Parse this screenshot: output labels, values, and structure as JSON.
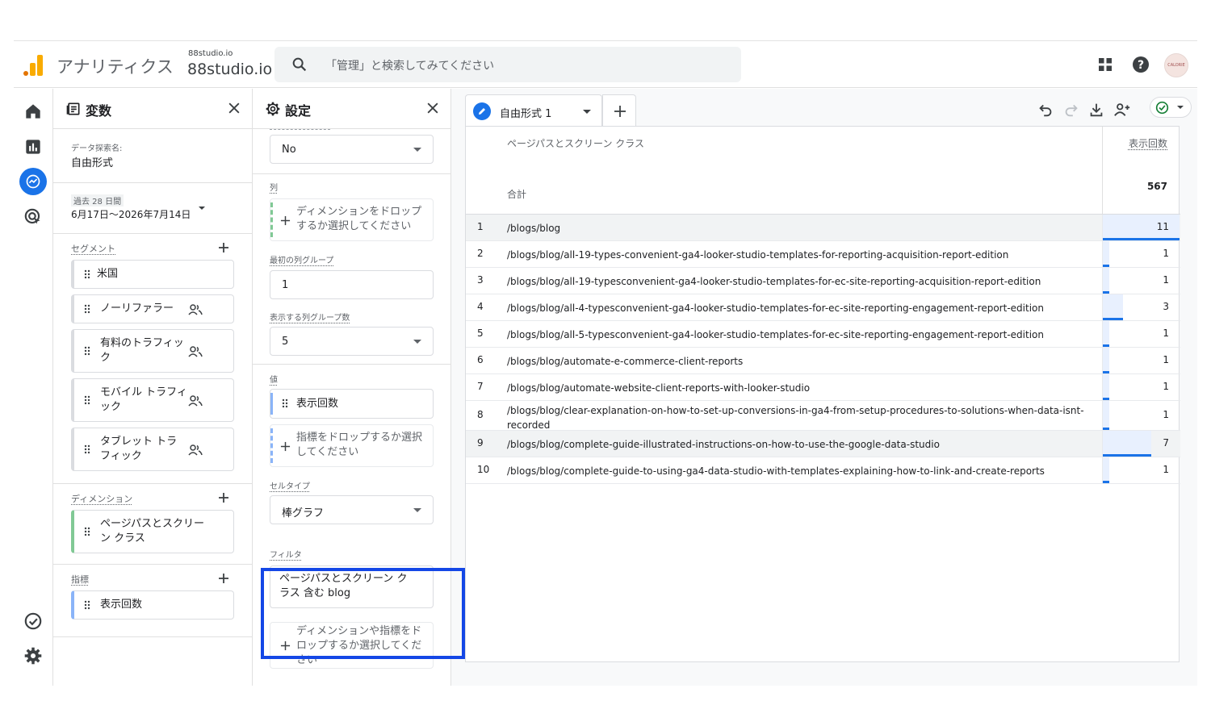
{
  "header": {
    "app_name": "アナリティクス",
    "property_small": "88studio.io",
    "property_name": "88studio.io",
    "search_placeholder": "「管理」と検索してみてください",
    "avatar_text": "CALORIE"
  },
  "variables_panel": {
    "title": "変数",
    "exploration_label": "データ探索名:",
    "exploration_name": "自由形式",
    "date_badge": "過去 28 日間",
    "date_range": "6月17日〜2026年7月14日",
    "segments_label": "セグメント",
    "segments": [
      "米国",
      "ノーリファラー",
      "有料のトラフィック",
      "モバイル トラフィック",
      "タブレット トラフィック"
    ],
    "dimensions_label": "ディメンション",
    "dimensions": [
      "ページパスとスクリーン クラス"
    ],
    "metrics_label": "指標",
    "metrics": [
      "表示回数"
    ]
  },
  "settings_panel": {
    "title": "設定",
    "show_rows_value": "No",
    "columns_label": "列",
    "columns_drop": "ディメンションをドロップするか選択してください",
    "first_group_label": "最初の列グループ",
    "first_group_value": "1",
    "groups_count_label": "表示する列グループ数",
    "groups_count_value": "5",
    "values_label": "値",
    "value_item": "表示回数",
    "values_drop": "指標をドロップするか選択してください",
    "cell_type_label": "セルタイプ",
    "cell_type_value": "棒グラフ",
    "filter_label": "フィルタ",
    "filter_value": "ページパスとスクリーン クラス 含む blog",
    "filter_drop": "ディメンションや指標をドロップするか選択してください"
  },
  "canvas": {
    "tab_name": "自由形式 1",
    "dimension_header": "ページパスとスクリーン クラス",
    "metric_header": "表示回数",
    "total_label": "合計",
    "total_value": "567",
    "rows": [
      {
        "n": "1",
        "path": "/blogs/blog",
        "value": "11",
        "share": 1.0
      },
      {
        "n": "2",
        "path": "/blogs/blog/all-19-types-convenient-ga4-looker-studio-templates-for-reporting-acquisition-report-edition",
        "value": "1",
        "share": 0.09
      },
      {
        "n": "3",
        "path": "/blogs/blog/all-19-typesconvenient-ga4-looker-studio-templates-for-ec-site-reporting-acquisition-report-edition",
        "value": "1",
        "share": 0.09
      },
      {
        "n": "4",
        "path": "/blogs/blog/all-4-typesconvenient-ga4-looker-studio-templates-for-ec-site-reporting-engagement-report-edition",
        "value": "3",
        "share": 0.27
      },
      {
        "n": "5",
        "path": "/blogs/blog/all-5-typesconvenient-ga4-looker-studio-templates-for-ec-site-reporting-engagement-report-edition",
        "value": "1",
        "share": 0.09
      },
      {
        "n": "6",
        "path": "/blogs/blog/automate-e-commerce-client-reports",
        "value": "1",
        "share": 0.09
      },
      {
        "n": "7",
        "path": "/blogs/blog/automate-website-client-reports-with-looker-studio",
        "value": "1",
        "share": 0.09
      },
      {
        "n": "8",
        "path": "/blogs/blog/clear-explanation-on-how-to-set-up-conversions-in-ga4-from-setup-procedures-to-solutions-when-data-isnt-recorded",
        "value": "1",
        "share": 0.09
      },
      {
        "n": "9",
        "path": "/blogs/blog/complete-guide-illustrated-instructions-on-how-to-use-the-google-data-studio",
        "value": "7",
        "share": 0.64
      },
      {
        "n": "10",
        "path": "/blogs/blog/complete-guide-to-using-ga4-data-studio-with-templates-explaining-how-to-link-and-create-reports",
        "value": "1",
        "share": 0.09
      }
    ]
  },
  "colors": {
    "accent": "#1a73e8",
    "highlight_border": "#1447e6",
    "dimension_bar": "#81c995",
    "metric_bar": "#8ab4f8",
    "logo_orange": "#f9ab00",
    "logo_dark_orange": "#e37400"
  }
}
